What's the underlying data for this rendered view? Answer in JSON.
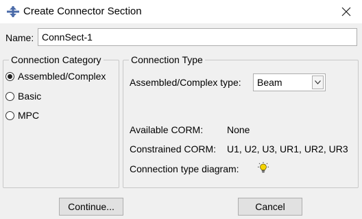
{
  "window": {
    "title": "Create Connector Section",
    "close_symbol": "✕",
    "icon": "connector-section-icon"
  },
  "name_field": {
    "label": "Name:",
    "value": "ConnSect-1"
  },
  "connection_category": {
    "legend": "Connection Category",
    "options": [
      {
        "label": "Assembled/Complex",
        "selected": true
      },
      {
        "label": "Basic",
        "selected": false
      },
      {
        "label": "MPC",
        "selected": false
      }
    ]
  },
  "connection_type": {
    "legend": "Connection Type",
    "type_label": "Assembled/Complex type:",
    "type_value": "Beam",
    "available_corm_label": "Available CORM:",
    "available_corm_value": "None",
    "constrained_corm_label": "Constrained CORM:",
    "constrained_corm_value": "U1, U2, U3, UR1, UR2, UR3",
    "diagram_label": "Connection type diagram:",
    "diagram_icon": "lightbulb-icon"
  },
  "buttons": {
    "continue": "Continue...",
    "cancel": "Cancel"
  },
  "colors": {
    "dialog_background": "#f0f0f0",
    "title_icon": "#4a6aa8",
    "bulb": "#f5d400"
  }
}
